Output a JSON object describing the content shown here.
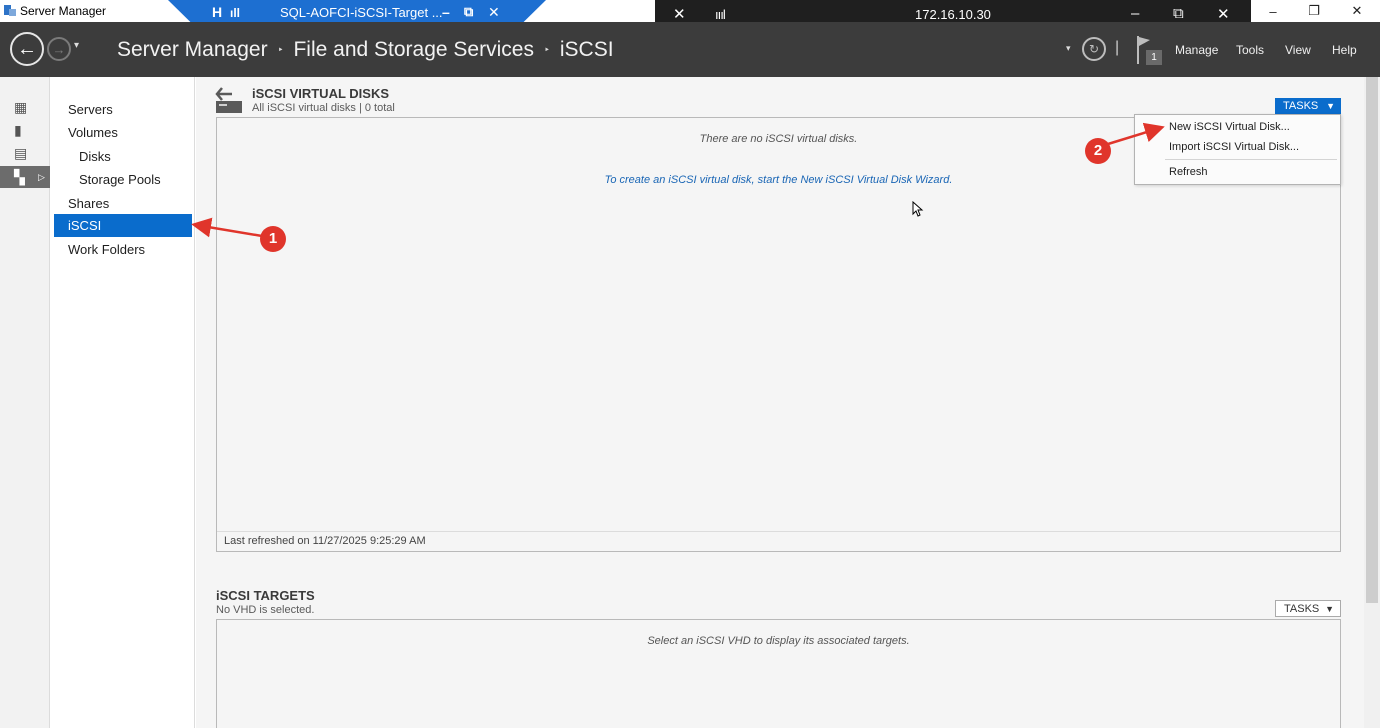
{
  "window": {
    "title": "Server Manager",
    "minimize": "–",
    "maximize": "❐",
    "close": "✕"
  },
  "rdp_bar": {
    "title": "SQL-AOFCI-iSCSI-Target ...",
    "pin_icon": "H",
    "signal_icon": "ıll",
    "minimize": "–",
    "restore": "⧉",
    "close": "✕"
  },
  "remote_bar": {
    "address": "172.16.10.30",
    "pin_icon": "✕",
    "signal_icon": "ıııl",
    "minimize": "–",
    "restore": "⧉",
    "close": "✕"
  },
  "header": {
    "back": "←",
    "forward": "→",
    "nav_dropdown": "▾",
    "breadcrumb": [
      "Server Manager",
      "File and Storage Services",
      "iSCSI"
    ],
    "breadcrumb_sep": "‣",
    "refresh_dropdown": "▾",
    "refresh_icon": "↻",
    "divider": "|",
    "notification_count": "1",
    "menus": [
      "Manage",
      "Tools",
      "View",
      "Help"
    ]
  },
  "rail": {
    "icons": [
      "dashboard-icon",
      "local-server-icon",
      "all-servers-icon",
      "file-storage-icon"
    ],
    "glyphs": [
      "▦",
      "▮",
      "▤",
      "▚"
    ],
    "expand": "▷"
  },
  "nav": {
    "items": [
      {
        "label": "Servers",
        "sub": false,
        "selected": false
      },
      {
        "label": "Volumes",
        "sub": false,
        "selected": false
      },
      {
        "label": "Disks",
        "sub": true,
        "selected": false
      },
      {
        "label": "Storage Pools",
        "sub": true,
        "selected": false
      },
      {
        "label": "Shares",
        "sub": false,
        "selected": false
      },
      {
        "label": "iSCSI",
        "sub": false,
        "selected": true
      },
      {
        "label": "Work Folders",
        "sub": false,
        "selected": false
      }
    ]
  },
  "virtual_disks": {
    "title": "iSCSI VIRTUAL DISKS",
    "subtitle": "All iSCSI virtual disks | 0 total",
    "tasks_label": "TASKS",
    "tasks_arrow": "▼",
    "empty_message": "There are no iSCSI virtual disks.",
    "wizard_link": "To create an iSCSI virtual disk, start the New iSCSI Virtual Disk Wizard.",
    "last_refreshed": "Last refreshed on 11/27/2025 9:25:29 AM"
  },
  "tasks_menu": {
    "items": [
      "New iSCSI Virtual Disk...",
      "Import iSCSI Virtual Disk...",
      "Refresh"
    ]
  },
  "targets": {
    "title": "iSCSI TARGETS",
    "subtitle": "No VHD is selected.",
    "tasks_label": "TASKS",
    "tasks_arrow": "▼",
    "empty_message": "Select an iSCSI VHD to display its associated targets."
  },
  "annotations": {
    "callout_1": "1",
    "callout_2": "2",
    "color": "#e0352b"
  },
  "colors": {
    "header_bg": "#3c3c3c",
    "accent": "#0a6ccc",
    "rdp_bar": "#1d6fd1"
  }
}
